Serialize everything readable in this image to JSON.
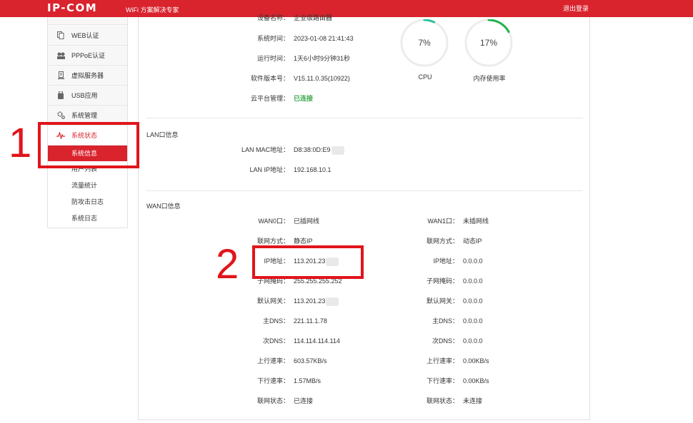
{
  "header": {
    "logo": "IP-COM",
    "slogan": "WiFi 方案解决专家",
    "logout": "退出登录"
  },
  "sidebar": {
    "items": [
      {
        "label": "WEB认证",
        "icon": "web-auth-icon"
      },
      {
        "label": "PPPoE认证",
        "icon": "pppoe-icon"
      },
      {
        "label": "虚拟服务器",
        "icon": "virtual-server-icon"
      },
      {
        "label": "USB应用",
        "icon": "usb-icon"
      },
      {
        "label": "系统管理",
        "icon": "gear-icon"
      },
      {
        "label": "系统状态",
        "icon": "pulse-icon"
      }
    ],
    "subitems": [
      "系统信息",
      "用户列表",
      "流量统计",
      "防攻击日志",
      "系统日志"
    ]
  },
  "system": {
    "device_name_label": "设备名称：",
    "device_name": "企业级路由器",
    "time_label": "系统时间：",
    "time": "2023-01-08 21:41:43",
    "uptime_label": "运行时间：",
    "uptime": "1天6小时9分钟31秒",
    "version_label": "软件版本号：",
    "version": "V15.11.0.35(10922)",
    "cloud_label": "云平台管理：",
    "cloud": "已连接"
  },
  "gauges": {
    "cpu": {
      "value": 7,
      "text": "7%",
      "label": "CPU",
      "color": "#2bbf9c"
    },
    "mem": {
      "value": 17,
      "text": "17%",
      "label": "内存使用率",
      "color": "#22b24c"
    }
  },
  "lan": {
    "title": "LAN口信息",
    "mac_label": "LAN MAC地址：",
    "mac": "D8:38:0D:E9",
    "ip_label": "LAN IP地址：",
    "ip": "192.168.10.1"
  },
  "wan": {
    "title": "WAN口信息",
    "wan0": {
      "port_label": "WAN0口：",
      "port": "已插网线",
      "mode_label": "联网方式：",
      "mode": "静态IP",
      "ip_label": "IP地址：",
      "ip": "113.201.23",
      "mask_label": "子网掩码：",
      "mask": "255.255.255.252",
      "gw_label": "默认网关：",
      "gw": "113.201.23",
      "dns1_label": "主DNS：",
      "dns1": "221.11.1.78",
      "dns2_label": "次DNS：",
      "dns2": "114.114.114.114",
      "up_label": "上行速率：",
      "up": "603.57KB/s",
      "down_label": "下行速率：",
      "down": "1.57MB/s",
      "status_label": "联网状态：",
      "status": "已连接"
    },
    "wan1": {
      "port_label": "WAN1口：",
      "port": "未插网线",
      "mode_label": "联网方式：",
      "mode": "动态IP",
      "ip_label": "IP地址：",
      "ip": "0.0.0.0",
      "mask_label": "子网掩码：",
      "mask": "0.0.0.0",
      "gw_label": "默认网关：",
      "gw": "0.0.0.0",
      "dns1_label": "主DNS：",
      "dns1": "0.0.0.0",
      "dns2_label": "次DNS：",
      "dns2": "0.0.0.0",
      "up_label": "上行速率：",
      "up": "0.00KB/s",
      "down_label": "下行速率：",
      "down": "0.00KB/s",
      "status_label": "联网状态：",
      "status": "未连接"
    }
  },
  "annotations": {
    "one": "1",
    "two": "2",
    "color": "#e0151b"
  }
}
